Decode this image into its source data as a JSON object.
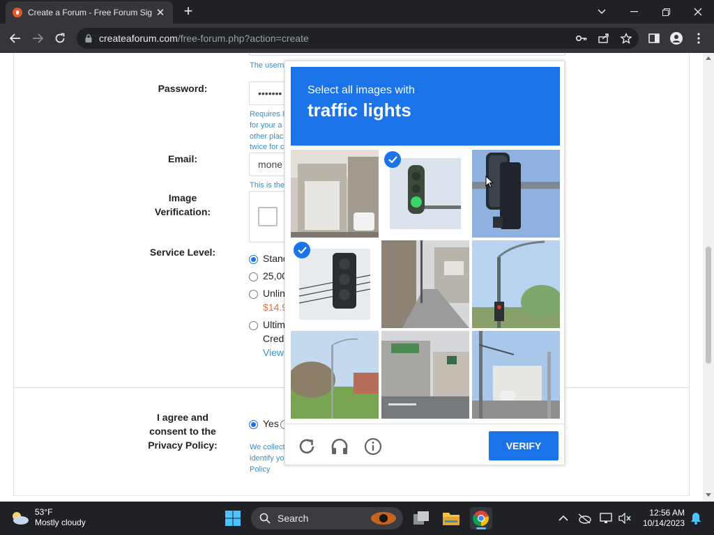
{
  "browser": {
    "tab_title": "Create a Forum - Free Forum Sig",
    "url_host": "createaforum.com",
    "url_path": "/free-forum.php?action=create"
  },
  "form": {
    "username_hint": "The usern",
    "password_label": "Password:",
    "password_value": "•••••••",
    "password_hint": [
      "Requires 8",
      "for your a",
      "other plac",
      "twice for c"
    ],
    "email_label": "Email:",
    "email_value": "mone",
    "email_hint": "This is the",
    "image_verification_label_line1": "Image",
    "image_verification_label_line2": "Verification:",
    "service_level_label": "Service Level:",
    "service_options": [
      "Stanc",
      "25,00",
      "Unlin",
      "Ultim"
    ],
    "service_price": "$14.9",
    "service_cred": "Cred",
    "service_view": "View",
    "privacy_label_line1": "I agree and",
    "privacy_label_line2": "consent to the",
    "privacy_label_line3": "Privacy Policy:",
    "privacy_yes": "Yes",
    "privacy_hint": [
      "We collect",
      "identify yo",
      "Policy"
    ]
  },
  "captcha": {
    "instruction": "Select all images with",
    "target": "traffic lights",
    "verify_label": "VERIFY",
    "selected_tiles": [
      1,
      3
    ],
    "accent": "#1a73e8"
  },
  "taskbar": {
    "temperature": "53°F",
    "weather": "Mostly cloudy",
    "search_label": "Search",
    "time": "12:56 AM",
    "date": "10/14/2023"
  }
}
